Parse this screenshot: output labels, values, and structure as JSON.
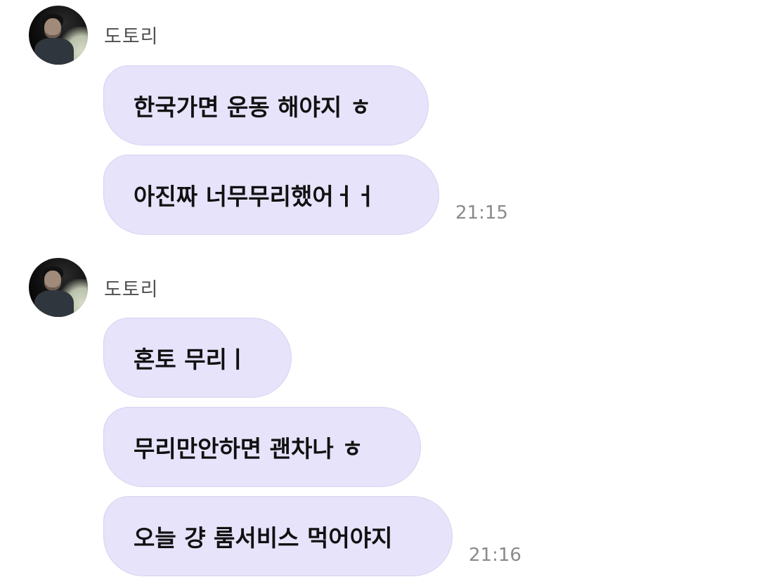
{
  "groups": [
    {
      "sender": "도토리",
      "avatar_icon": "profile-photo",
      "messages": [
        {
          "text": "한국가면 운동 해야지 ㅎ"
        },
        {
          "text": "아진짜 너무무리했어ㅓㅓ"
        }
      ],
      "time": "21:15"
    },
    {
      "sender": "도토리",
      "avatar_icon": "profile-photo",
      "messages": [
        {
          "text": "혼토 무리ㅣ"
        },
        {
          "text": "무리만안하면 괜차나 ㅎ"
        },
        {
          "text": "오늘 걍 룸서비스 먹어야지"
        }
      ],
      "time": "21:16"
    }
  ],
  "colors": {
    "bubble_bg": "#e6e3fb",
    "bubble_border": "#d6d2f1",
    "sender_text": "#505050",
    "time_text": "#8a8a8a",
    "message_text": "#111111"
  }
}
